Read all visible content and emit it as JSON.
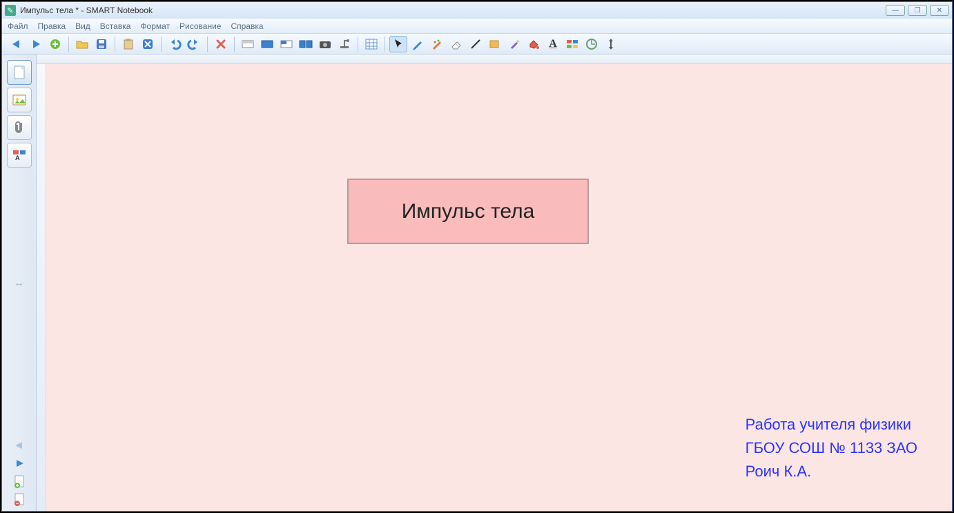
{
  "window": {
    "title": "Импульс тела * - SMART Notebook"
  },
  "menu": {
    "file": "Файл",
    "edit": "Правка",
    "view": "Вид",
    "insert": "Вставка",
    "format": "Формат",
    "drawing": "Рисование",
    "help": "Справка"
  },
  "icons": {
    "back": "←",
    "forward": "→",
    "addpage": "＋",
    "open": "📂",
    "save": "💾",
    "paste": "📋",
    "cut": "✂",
    "undo": "↶",
    "redo": "↷",
    "delete": "✖",
    "fs1": "▭",
    "fs2": "▭",
    "fs3": "▭",
    "fs4": "▭",
    "camera": "📷",
    "spotlight": "▼",
    "table": "▦",
    "cursor": "↖",
    "pen": "✎",
    "highlighter": "∥",
    "eraser": "⌫",
    "line": "╱",
    "shape": "▢",
    "magicpen": "✨",
    "fill": "🪣",
    "text": "A",
    "props": "≣",
    "compass": "⊕",
    "measure": "↕"
  },
  "sidebar": {
    "tabs": {
      "pages": "pages",
      "gallery": "gallery",
      "attach": "attach",
      "props": "props"
    },
    "resize": "↔",
    "nav": {
      "prev": "←",
      "next": "→",
      "add": "＋",
      "del": "⊘"
    }
  },
  "slide": {
    "title": "Импульс тела",
    "credit_line1": "Работа учителя физики",
    "credit_line2": "ГБОУ СОШ № 1133 ЗАО",
    "credit_line3": "Роич К.А."
  },
  "winbtns": {
    "min": "—",
    "max": "❐",
    "close": "✕"
  }
}
